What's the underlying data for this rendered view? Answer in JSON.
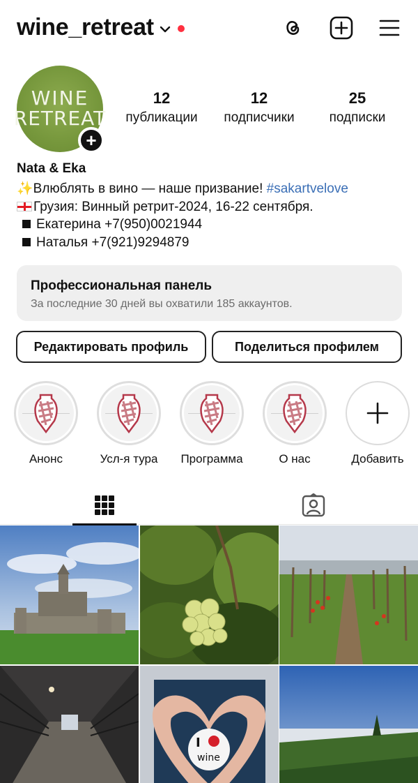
{
  "header": {
    "username": "wine_retreat",
    "notification_dot_color": "#ff3040",
    "icons": [
      "chevron-down-icon",
      "threads-icon",
      "new-post-icon",
      "menu-icon"
    ]
  },
  "profile": {
    "avatar_text_line1": "WINE",
    "avatar_text_line2": "RETREAT",
    "stats": [
      {
        "value": "12",
        "label": "публикации"
      },
      {
        "value": "12",
        "label": "подписчики"
      },
      {
        "value": "25",
        "label": "подписки"
      }
    ],
    "display_name": "Nata & Eka",
    "bio": {
      "line1_emoji": "✨",
      "line1_text": "Влюблять в вино — наше призвание! ",
      "line1_hashtag": "#sakartvelove",
      "line2_text": "Грузия: Винный ретрит-2024, 16-22 сентября.",
      "line3_text": "Екатерина +7(950)0021944",
      "line4_text": "Наталья +7(921)9294879"
    }
  },
  "pro_panel": {
    "title": "Профессиональная панель",
    "subtitle": "За последние 30 дней вы охватили 185 аккаунтов."
  },
  "buttons": {
    "edit_profile": "Редактировать профиль",
    "share_profile": "Поделиться профилем"
  },
  "highlights": [
    {
      "label": "Анонс"
    },
    {
      "label": "Усл-я тура"
    },
    {
      "label": "Программа"
    },
    {
      "label": "О нас"
    },
    {
      "label": "Добавить"
    }
  ],
  "tabs": [
    "grid-icon",
    "tagged-icon"
  ],
  "posts": [
    {
      "description": "monastery"
    },
    {
      "description": "grapes"
    },
    {
      "description": "vineyard"
    },
    {
      "description": "wine-cellar"
    },
    {
      "description": "heart-hands"
    },
    {
      "description": "landscape"
    }
  ],
  "colors": {
    "hashtag": "#3b6fb6",
    "panel_bg": "#efefef",
    "avatar_green": "#76973c"
  }
}
